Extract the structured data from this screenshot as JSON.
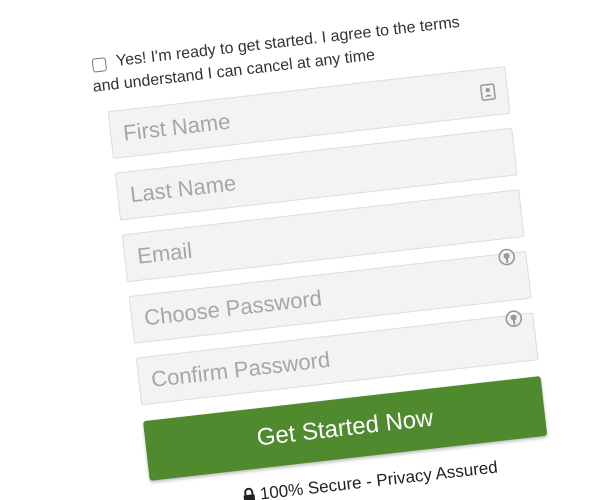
{
  "consent": {
    "line1": "Yes! I'm ready to get started. I agree to the terms",
    "line2": "and understand I can cancel at any time",
    "checked": false
  },
  "fields": {
    "first_name": {
      "placeholder": "First Name",
      "value": ""
    },
    "last_name": {
      "placeholder": "Last Name",
      "value": ""
    },
    "email": {
      "placeholder": "Email",
      "value": ""
    },
    "password": {
      "placeholder": "Choose Password",
      "value": ""
    },
    "confirm_password": {
      "placeholder": "Confirm Password",
      "value": ""
    }
  },
  "submit": {
    "label": "Get Started Now"
  },
  "secure": {
    "text": "100% Secure - Privacy Assured"
  },
  "icons": {
    "contact_card": "contact-card-icon",
    "password_manager": "password-key-icon",
    "lock": "lock-icon"
  },
  "colors": {
    "button": "#4f8b2e",
    "field_bg": "#f3f3f3",
    "placeholder": "#a6a6a6"
  }
}
